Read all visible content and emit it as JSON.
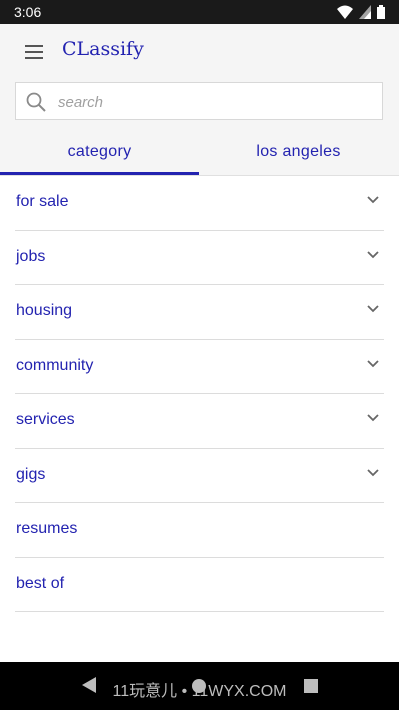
{
  "status": {
    "time": "3:06"
  },
  "app": {
    "title": "CLassify"
  },
  "search": {
    "placeholder": "search"
  },
  "tabs": [
    {
      "label": "category",
      "active": true
    },
    {
      "label": "los angeles",
      "active": false
    }
  ],
  "categories": [
    {
      "label": "for sale",
      "expandable": true
    },
    {
      "label": "jobs",
      "expandable": true
    },
    {
      "label": "housing",
      "expandable": true
    },
    {
      "label": "community",
      "expandable": true
    },
    {
      "label": "services",
      "expandable": true
    },
    {
      "label": "gigs",
      "expandable": true
    },
    {
      "label": "resumes",
      "expandable": false
    },
    {
      "label": "best of",
      "expandable": false
    }
  ],
  "navbar": {
    "watermark": "11玩意儿 • 11WYX.COM"
  },
  "colors": {
    "accent": "#2323b0",
    "divider": "#dcdcdc",
    "background": "#f5f5f5"
  },
  "icons": [
    "menu-icon",
    "search-icon",
    "chevron-down-icon",
    "wifi-icon",
    "signal-icon",
    "battery-icon"
  ]
}
